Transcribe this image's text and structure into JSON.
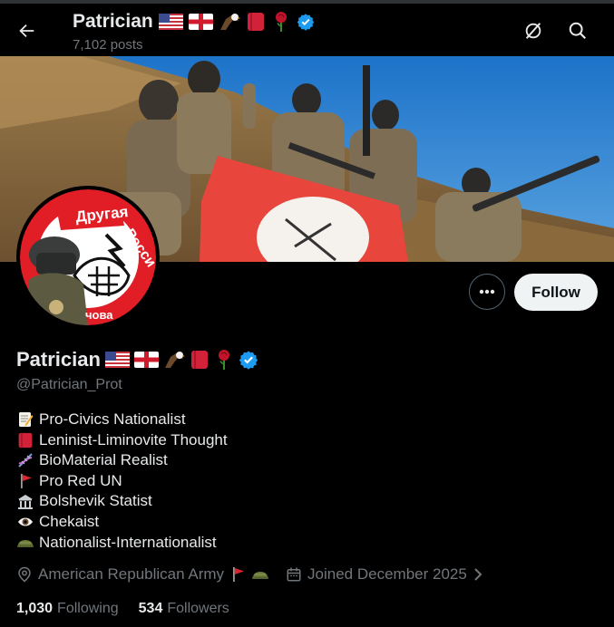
{
  "header": {
    "name": "Patrician",
    "posts": "7,102 posts"
  },
  "profile": {
    "name": "Patrician",
    "handle": "@Patrician_Prot",
    "follow_label": "Follow",
    "bio": [
      {
        "icon": "memo-icon",
        "text": "Pro-Civics Nationalist"
      },
      {
        "icon": "red-book-icon",
        "text": "Leninist-Liminovite Thought"
      },
      {
        "icon": "dna-icon",
        "text": "BioMaterial Realist"
      },
      {
        "icon": "red-flag-icon",
        "text": "Pro Red UN"
      },
      {
        "icon": "classical-building-icon",
        "text": "Bolshevik Statist"
      },
      {
        "icon": "eye-icon",
        "text": "Chekaist"
      },
      {
        "icon": "military-helmet-icon",
        "text": "Nationalist-Internationalist"
      }
    ],
    "location": "American Republican Army",
    "joined": "Joined December 2025",
    "following_count": "1,030",
    "following_label": "Following",
    "followers_count": "534",
    "followers_label": "Followers"
  },
  "banner": {
    "flag_text": "",
    "avatar_text": "Другая Росси"
  },
  "colors": {
    "verified": "#1d9bf0",
    "muted": "#71767b",
    "text": "#e7e9ea",
    "flag_red": "#e8453c"
  }
}
